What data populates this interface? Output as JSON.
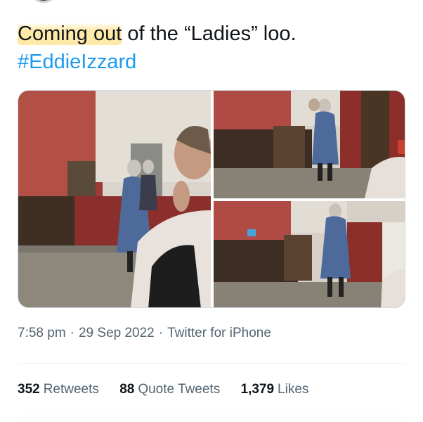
{
  "tweet": {
    "text_highlighted": "Coming out",
    "text_rest": " of the “Ladies” loo.",
    "hashtag": "#EddieIzzard"
  },
  "media": {
    "photos": [
      {
        "icon": "photo-people-hallway-left"
      },
      {
        "icon": "photo-people-hallway-top-right"
      },
      {
        "icon": "photo-people-hallway-bottom-right"
      }
    ]
  },
  "meta": {
    "time": "7:58 pm",
    "date": "29 Sep 2022",
    "source": "Twitter for iPhone",
    "separator": "·"
  },
  "stats": {
    "retweets_count": "352",
    "retweets_label": "Retweets",
    "quotes_count": "88",
    "quotes_label": "Quote Tweets",
    "likes_count": "1,379",
    "likes_label": "Likes"
  },
  "colors": {
    "link": "#1d9bf0",
    "secondary_text": "#536471",
    "highlight": "#ffe28c"
  }
}
